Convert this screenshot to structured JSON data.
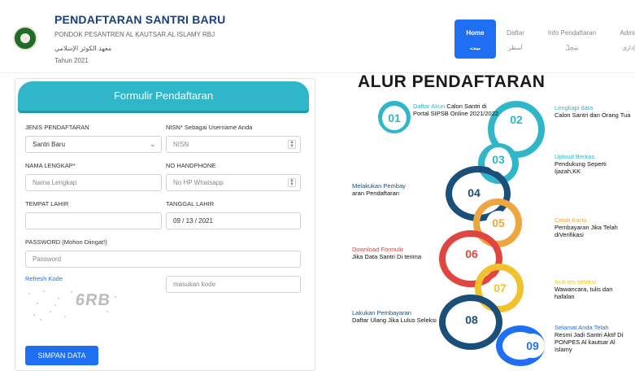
{
  "brand": {
    "title": "PENDAFTARAN SANTRI BARU",
    "subtitle": "PONDOK PESANTREN AL KAUTSAR AL ISLAMY RBJ",
    "arabic": "معهد الكوثر الإسلامي",
    "year": "Tahun 2021"
  },
  "nav": [
    {
      "label": "Home",
      "arabic": "بيت"
    },
    {
      "label": "Daftar",
      "arabic": "أسطر"
    },
    {
      "label": "Info Pendaftaran",
      "arabic": "سِجِلّ"
    },
    {
      "label": "Admir",
      "arabic": "إداري"
    }
  ],
  "form": {
    "heading": "Formulir Pendaftaran",
    "jenis_label": "JENIS PENDAFTARAN",
    "jenis_value": "Santri Baru",
    "nisn_label": "NISN* Sebagai Username Anda",
    "nisn_placeholder": "NISN",
    "nama_label": "NAMA LENGKAP*",
    "nama_placeholder": "Nama Lengkap",
    "hp_label": "NO HANDPHONE",
    "hp_placeholder": "No HP Whatsapp",
    "tempat_label": "TEMPAT LAHIR",
    "tempat_value": "",
    "tgl_label": "TANGGAL LAHIR",
    "tgl_value": "09 / 13 / 2021",
    "password_label": "PASSWORD (Mohon Diingat!)",
    "password_placeholder": "Password",
    "refresh_label": "Refresh Kode",
    "captcha_text": "6RB",
    "kode_placeholder": "masukan kode",
    "submit_label": "SIMPAN DATA"
  },
  "alur": {
    "title": "ALUR PENDAFTARAN",
    "steps": [
      {
        "num": "01",
        "accent": "Daftar Akun",
        "rest": "Calon Santri di Portal SIPSB Online 2021/2022",
        "color": "#2fb6c8"
      },
      {
        "num": "02",
        "accent": "Lengkapi data",
        "rest": "Calon Santri dan Orang Tua",
        "color": "#2fb6c8"
      },
      {
        "num": "03",
        "accent": "Uploud Berkas",
        "rest": "Pendukung Seperti Ijazah,KK",
        "color": "#2fb6c8"
      },
      {
        "num": "04",
        "accent": "Melakukan Pembay",
        "rest": "aran Pendaftaran",
        "color": "#1a4f7a"
      },
      {
        "num": "05",
        "accent": "Cetak Kartu",
        "rest": "Pembayaran Jika Telah diVerifikasi",
        "color": "#f0a640"
      },
      {
        "num": "06",
        "accent": "Download Formulir",
        "rest": "Jika Data Santri Di terima",
        "color": "#e0453f"
      },
      {
        "num": "07",
        "accent": "Ikuti tes seleksi",
        "rest": "Wawancara, tulis dan hafalan",
        "color": "#f2c12e"
      },
      {
        "num": "08",
        "accent": "Lakukan Pembayaran",
        "rest": "Daftar Ulang Jika Lulus Seleksi",
        "color": "#1a4f7a"
      },
      {
        "num": "09",
        "accent": "Selamat Anda Telah",
        "rest": "Resmi Jadi Santri Aktif Di PONPES Al kautsar Al Islamy",
        "color": "#1f6ff2"
      }
    ]
  },
  "colors": {
    "primary": "#1f6ff2",
    "teal": "#2fb6c8",
    "brand": "#1a3f7a"
  }
}
